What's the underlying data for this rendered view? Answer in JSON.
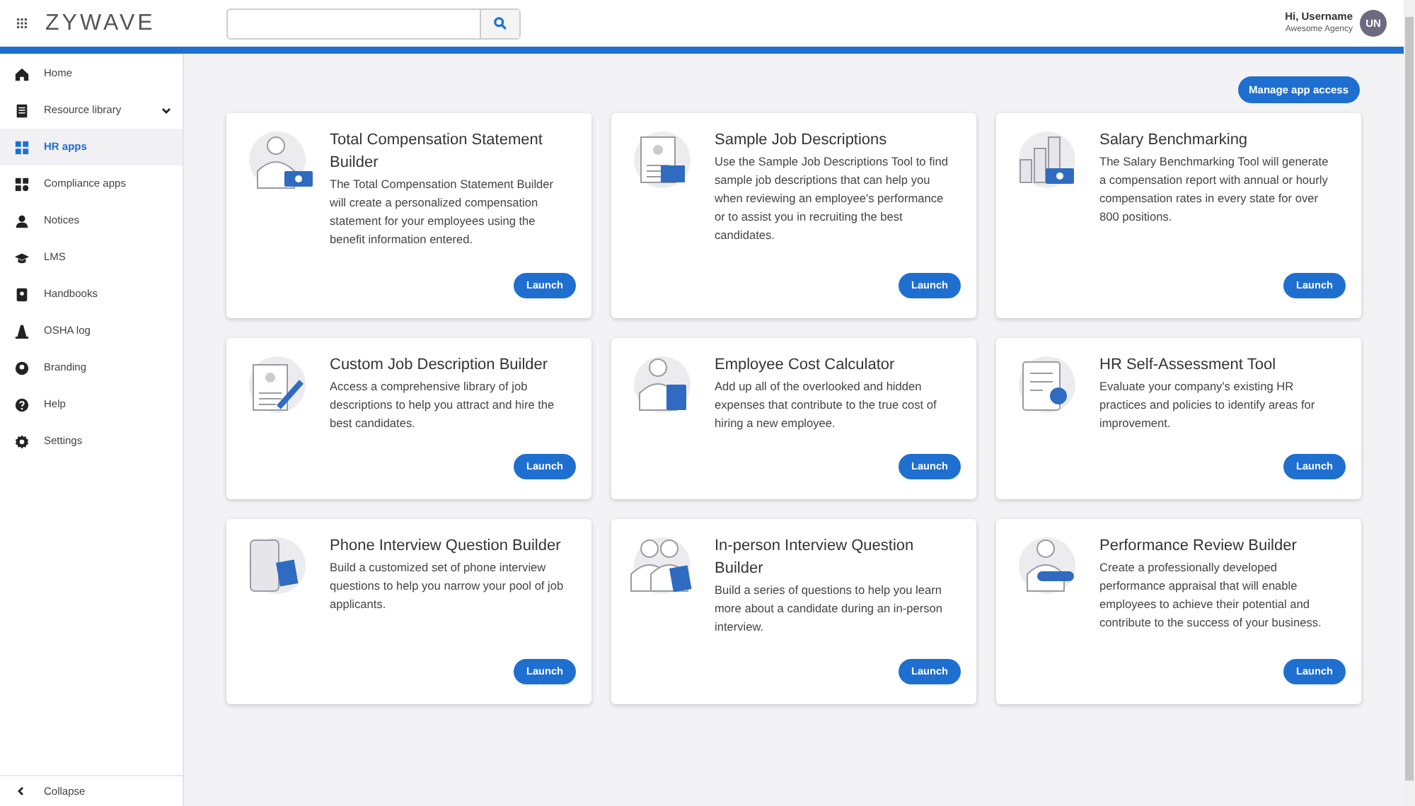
{
  "header": {
    "logo": "ZYWAVE",
    "user": {
      "greeting": "Hi, Username",
      "agency": "Awesome Agency",
      "initials": "UN"
    }
  },
  "sidebar": {
    "items": [
      {
        "label": "Home",
        "selected": false,
        "expandable": false
      },
      {
        "label": "Resource library",
        "selected": false,
        "expandable": true
      },
      {
        "label": "HR apps",
        "selected": true,
        "expandable": false
      },
      {
        "label": "Compliance apps",
        "selected": false,
        "expandable": false
      },
      {
        "label": "Notices",
        "selected": false,
        "expandable": false
      },
      {
        "label": "LMS",
        "selected": false,
        "expandable": false
      },
      {
        "label": "Handbooks",
        "selected": false,
        "expandable": false
      },
      {
        "label": "OSHA log",
        "selected": false,
        "expandable": false
      },
      {
        "label": "Branding",
        "selected": false,
        "expandable": false
      },
      {
        "label": "Help",
        "selected": false,
        "expandable": false
      },
      {
        "label": "Settings",
        "selected": false,
        "expandable": false
      }
    ],
    "collapse": "Collapse"
  },
  "manage_button": "Manage app access",
  "apps": [
    {
      "title": "Total Compensation Statement Builder",
      "description": "The Total Compensation Statement Builder will create a personalized compensation statement for your employees using the benefit information entered.",
      "button": "Launch"
    },
    {
      "title": "Sample Job Descriptions",
      "description": "Use the Sample Job Descriptions Tool to find sample job descriptions that can help you when reviewing an employee's performance or to assist you in recruiting the best candidates.",
      "button": "Launch"
    },
    {
      "title": "Salary Benchmarking",
      "description": "The Salary Benchmarking Tool will generate a compensation report with annual or hourly compensation rates in every state for over 800 positions.",
      "button": "Launch"
    },
    {
      "title": "Custom Job Description Builder",
      "description": "Access a comprehensive library of job descriptions to help you attract and hire the best candidates.",
      "button": "Launch"
    },
    {
      "title": "Employee Cost Calculator",
      "description": "Add up all of the overlooked and hidden expenses that contribute to the true cost of hiring a new employee.",
      "button": "Launch"
    },
    {
      "title": "HR Self-Assessment Tool",
      "description": "Evaluate your company's existing HR practices and policies to identify areas for improvement.",
      "button": "Launch"
    },
    {
      "title": "Phone Interview Question Builder",
      "description": "Build a customized set of phone interview questions to help you narrow your pool of job applicants.",
      "button": "Launch"
    },
    {
      "title": "In-person Interview Question Builder",
      "description": "Build a series of questions to help you learn more about a candidate during an in-person interview.",
      "button": "Launch"
    },
    {
      "title": "Performance Review Builder",
      "description": "Create a professionally developed performance appraisal that will enable employees to achieve their potential and contribute to the success of your business.",
      "button": "Launch"
    }
  ]
}
